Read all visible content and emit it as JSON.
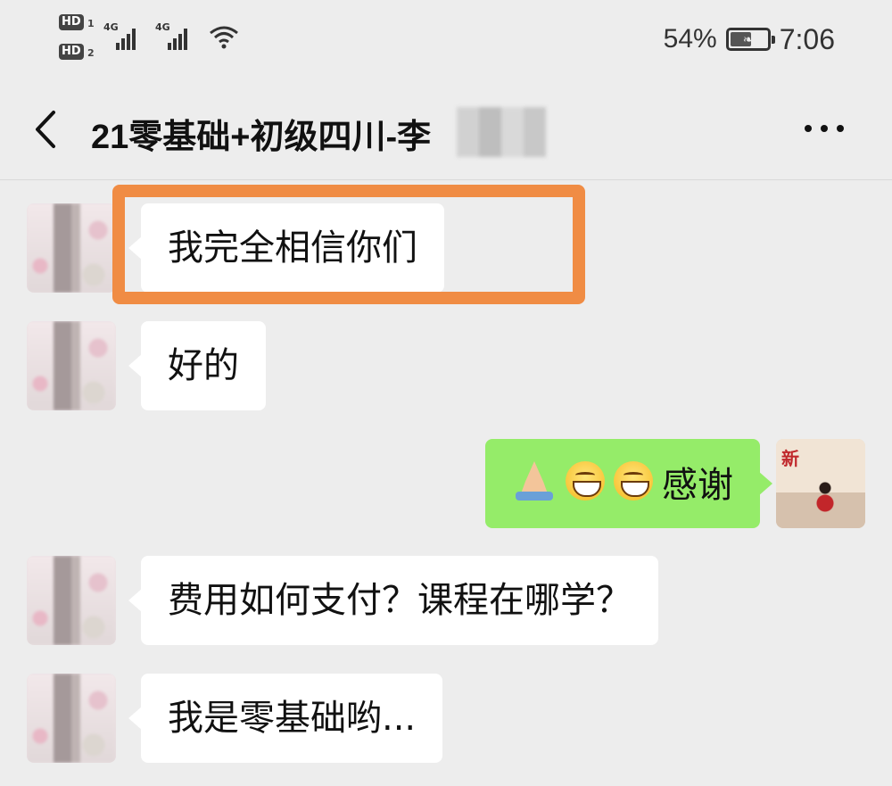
{
  "status_bar": {
    "sim1_badge": "HD",
    "sim1_index": "1",
    "sim2_badge": "HD",
    "sim2_index": "2",
    "net1": "4G",
    "net2": "4G",
    "battery_percent": "54%",
    "battery_level": 0.54,
    "time": "7:06"
  },
  "header": {
    "title": "21零基础+初级四川-李",
    "back_icon": "chevron-left-icon",
    "more_icon": "more-dots-icon"
  },
  "messages": [
    {
      "side": "left",
      "text": "我完全相信你们",
      "highlighted": true
    },
    {
      "side": "left",
      "text": "好的"
    },
    {
      "side": "right",
      "emojis": [
        "folded-hands-icon",
        "grinning-face-icon",
        "grinning-face-icon"
      ],
      "text": "感谢"
    },
    {
      "side": "left",
      "text": "费用如何支付？课程在哪学？"
    },
    {
      "side": "left",
      "text": "我是零基础哟..."
    }
  ],
  "colors": {
    "background": "#ededed",
    "bubble_in": "#ffffff",
    "bubble_out": "#95ec69",
    "highlight": "#f08c44"
  }
}
